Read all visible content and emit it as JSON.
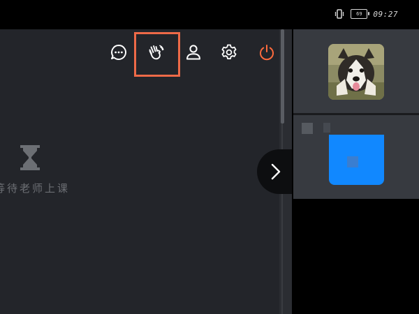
{
  "status_bar": {
    "time": "09:27",
    "battery_level": "69",
    "icons": [
      "vibrate-icon",
      "battery-icon"
    ]
  },
  "classroom": {
    "waiting_text": "等待老师上课",
    "toolbar": [
      {
        "name": "chat",
        "icon": "chat-bubble-icon"
      },
      {
        "name": "raise-hand",
        "icon": "hand-wave-icon",
        "highlighted": true
      },
      {
        "name": "user",
        "icon": "user-icon"
      },
      {
        "name": "settings",
        "icon": "gear-icon"
      },
      {
        "name": "power",
        "icon": "power-icon",
        "color": "#ff6b3d"
      }
    ]
  },
  "colors": {
    "highlight": "#ee6a48",
    "power": "#ff6b3d",
    "blue_tile": "#1188ff",
    "classroom_bg": "#23252a",
    "panel_bg": "#373a40"
  }
}
